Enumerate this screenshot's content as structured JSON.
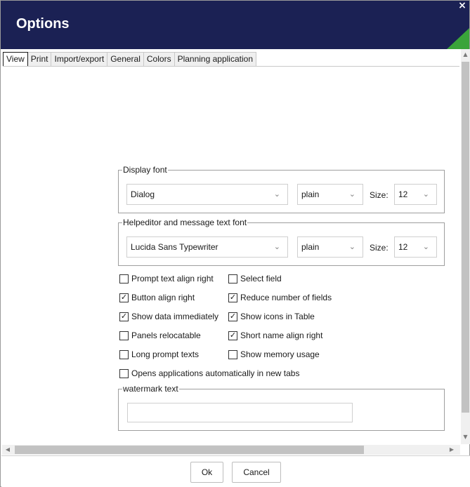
{
  "window": {
    "title": "Options",
    "close_icon": "×"
  },
  "tabs": [
    {
      "label": "View",
      "active": true
    },
    {
      "label": "Print"
    },
    {
      "label": "Import/export"
    },
    {
      "label": "General"
    },
    {
      "label": "Colors"
    },
    {
      "label": "Planning application"
    }
  ],
  "display_font": {
    "legend": "Display font",
    "family": "Dialog",
    "style": "plain",
    "size_label": "Size:",
    "size": "12"
  },
  "help_font": {
    "legend": "Helpeditor and message text font",
    "family": "Lucida Sans Typewriter",
    "style": "plain",
    "size_label": "Size:",
    "size": "12"
  },
  "checkboxes": {
    "prompt_text_align_right": {
      "label": "Prompt text align right",
      "checked": false
    },
    "select_field": {
      "label": "Select field",
      "checked": false
    },
    "button_align_right": {
      "label": "Button align right",
      "checked": true
    },
    "reduce_number_of_fields": {
      "label": "Reduce number of fields",
      "checked": true
    },
    "show_data_immediately": {
      "label": "Show data immediately",
      "checked": true
    },
    "show_icons_in_table": {
      "label": "Show icons in Table",
      "checked": true
    },
    "panels_relocatable": {
      "label": "Panels relocatable",
      "checked": false
    },
    "short_name_align_right": {
      "label": "Short name align right",
      "checked": true
    },
    "long_prompt_texts": {
      "label": "Long prompt texts",
      "checked": false
    },
    "show_memory_usage": {
      "label": "Show memory usage",
      "checked": false
    },
    "opens_apps_new_tabs": {
      "label": "Opens applications automatically in new tabs",
      "checked": false
    }
  },
  "watermark": {
    "legend": "watermark text",
    "value": ""
  },
  "footer": {
    "ok_label": "Ok",
    "cancel_label": "Cancel"
  },
  "colors": {
    "title_bg": "#1b2154",
    "accent": "#3aa43a"
  }
}
